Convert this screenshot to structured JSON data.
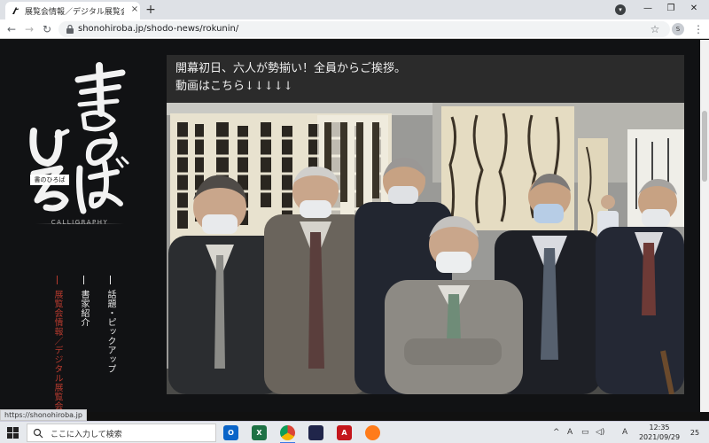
{
  "browser": {
    "tab_title": "展覧会情報／デジタル展覧会-六人",
    "tab_close": "×",
    "new_tab": "+",
    "tab_search": "▾",
    "window_buttons": {
      "minimize": "—",
      "maximize": "❐",
      "close": "✕"
    },
    "nav": {
      "back": "←",
      "forward": "→",
      "reload": "↻"
    },
    "url": "shonohiroba.jp/shodo-news/rokunin/",
    "star": "☆",
    "avatar": "S",
    "menu": "⋮",
    "status_url": "https://shonohiroba.jp"
  },
  "site": {
    "logo_sub": "書のひろば",
    "logo_caption": "CALLIGRAPHY",
    "nav": {
      "topics": "話題・ピックアップ",
      "artists": "書家紹介",
      "exhibitions": "展覧会情報／デジタル展覧会"
    },
    "headline_lines": [
      "開幕初日、六人が勢揃い！全員からご挨拶。",
      "動画はこちら↓↓↓↓↓"
    ],
    "colors": {
      "background": "#111214",
      "exhibition_nav": "#b53a2e"
    }
  },
  "taskbar": {
    "search_placeholder": "ここに入力して検索",
    "apps": [
      {
        "name": "outlook-icon",
        "label": "O",
        "color": "#0a64c8"
      },
      {
        "name": "excel-icon",
        "label": "X",
        "color": "#1e7145"
      },
      {
        "name": "chrome-icon",
        "label": "",
        "color": "#f2b50f"
      },
      {
        "name": "calligraphy-app-icon",
        "label": "",
        "color": "#20254a"
      },
      {
        "name": "acrobat-icon",
        "label": "A",
        "color": "#c4161c"
      },
      {
        "name": "firefox-icon",
        "label": "",
        "color": "#ff7b1a"
      }
    ],
    "tray": {
      "chevron": "^",
      "ime": "A",
      "network": "▭",
      "volume": "◁)",
      "lang": "A"
    },
    "time": "12:35",
    "date": "2021/09/29",
    "notifications": "25"
  }
}
